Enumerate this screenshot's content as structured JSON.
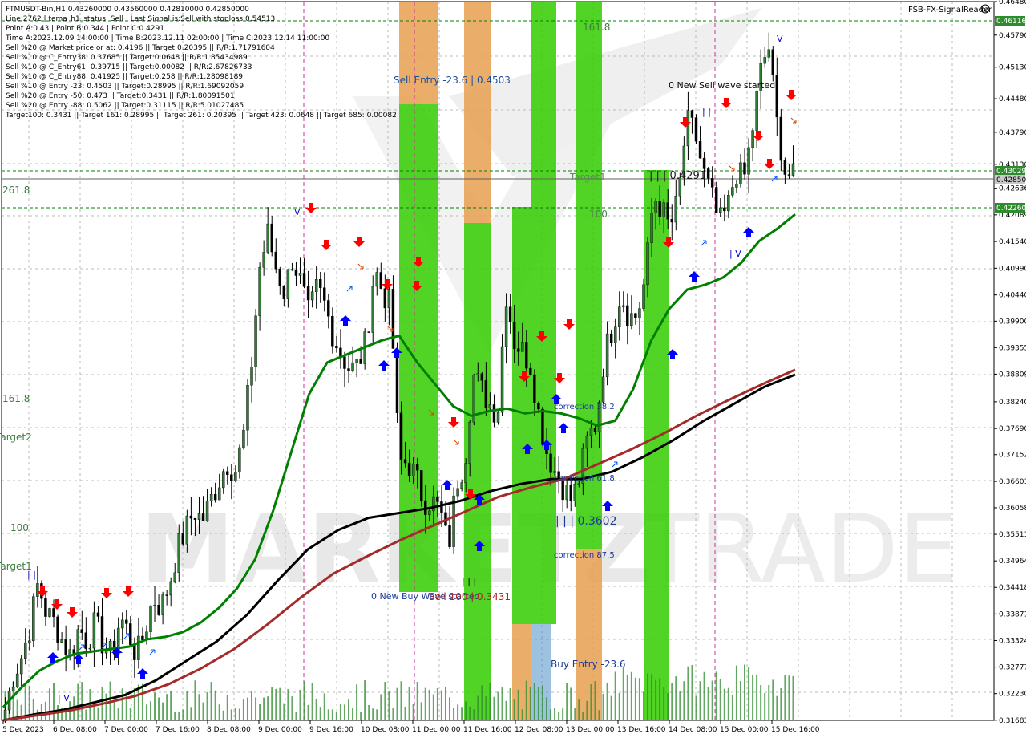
{
  "header": {
    "symbol_line": "FTMUSDT-Bin,H1  0.43260000 0.43560000 0.42810000 0.42850000",
    "lines": [
      "Line:2762 | tema_h1_status: Sell | Last Signal is:Sell with stoploss:0.54513",
      "Point A:0.43 | Point B:0.344 | Point C:0.4291",
      "Time A:2023.12.09 14:00:00 | Time B:2023.12.11 02:00:00 | Time C:2023.12.14 11:00:00",
      "Sell %20 @ Market price or at: 0.4196 || Target:0.20395 || R/R:1.71791604",
      "Sell %10 @ C_Entry38: 0.37685 || Target:0.0648 || R/R:1.85434989",
      "Sell %10 @ C_Entry61: 0.39715 || Target:0.00082 || R/R:2.67826733",
      "Sell %10 @ C_Entry88: 0.41925 || Target:0.258 || R/R:1.28098189",
      "Sell %10 @ Entry -23: 0.4503 || Target:0.28995 || R/R:1.69092059",
      "Sell %20 @ Entry -50: 0.473 || Target:0.3431 || R/R:1.80091501",
      "Sell %20 @ Entry -88: 0.5062 || Target:0.31115 || R/R:5.01027485",
      "Target100: 0.3431 || Target 161: 0.28995 || Target 261: 0.20395 || Target 423: 0.0648 || Target 685: 0.00082"
    ]
  },
  "brand": "FSB-FX-SignalReader",
  "watermark": {
    "left": "MARKETZ",
    "right": "TRADE"
  },
  "annotations": {
    "sell_entry": "Sell Entry -23.6 | 0.4503",
    "level_161_top": "161.8",
    "target1_right": "Target1",
    "point_c": "| | | 0.4291",
    "level_100_mid": "100",
    "new_sell_wave": "0 New Sell wave started",
    "correction_382": "correction 38.2",
    "correction_618": "correction 61.8",
    "point_b": "| | | 0.3602",
    "correction_875": "correction 87.5",
    "new_buy_wave": "0 New Buy Wave started",
    "sell_100": "Sell 100 | 0.3431",
    "buy_entry": "Buy Entry -23.6",
    "left_2618": "261.8",
    "left_1618": "161.8",
    "left_target2": "Target2",
    "left_100": "100",
    "left_target1": "Target1",
    "top_v": "V",
    "top_v2": "V",
    "bars_1": "| |",
    "bars_2": "| V",
    "bars_3": "| V",
    "bars_4": "| |",
    "bars_5": "| | |"
  },
  "colors": {
    "bull_green": "#2e7d32",
    "sell_arrow": "#ff0000",
    "buy_arrow": "#0000ff",
    "zone_green": "#33cc00",
    "zone_orange": "#e6a050",
    "ma_green": "#008000",
    "ma_black": "#000000",
    "ma_red": "#a52a2a",
    "level_line": "#008000",
    "current_price_bg": "#c0c0c0",
    "level_label_bg": "#2e8b2e"
  },
  "price_labels": {
    "upper_level": "0.46116",
    "target_level": "0.43029",
    "current_price": "0.42850",
    "lower_level": "0.42260"
  },
  "chart_data": {
    "type": "candlestick",
    "symbol": "FTMUSDT-Bin",
    "timeframe": "H1",
    "ylim": [
      0.3168,
      0.4648
    ],
    "y_ticks": [
      "0.46480",
      "0.45790",
      "0.45130",
      "0.44480",
      "0.43790",
      "0.43130",
      "0.42636",
      "0.42089",
      "0.41540",
      "0.40990",
      "0.40440",
      "0.39900",
      "0.39355",
      "0.38809",
      "0.38240",
      "0.37690",
      "0.37152",
      "0.36601",
      "0.36058",
      "0.35511",
      "0.34964",
      "0.34418",
      "0.33871",
      "0.33324",
      "0.32777",
      "0.32230",
      "0.31683"
    ],
    "x_ticks": [
      "5 Dec 2023",
      "6 Dec 08:00",
      "7 Dec 00:00",
      "7 Dec 16:00",
      "8 Dec 08:00",
      "9 Dec 00:00",
      "9 Dec 16:00",
      "10 Dec 08:00",
      "11 Dec 00:00",
      "11 Dec 16:00",
      "12 Dec 08:00",
      "13 Dec 00:00",
      "13 Dec 16:00",
      "14 Dec 08:00",
      "15 Dec 00:00",
      "15 Dec 16:00"
    ],
    "close_path": [
      0.319,
      0.326,
      0.33,
      0.336,
      0.345,
      0.339,
      0.337,
      0.333,
      0.33,
      0.336,
      0.333,
      0.337,
      0.332,
      0.33,
      0.338,
      0.335,
      0.33,
      0.335,
      0.342,
      0.34,
      0.345,
      0.352,
      0.356,
      0.36,
      0.358,
      0.362,
      0.366,
      0.37,
      0.368,
      0.375,
      0.39,
      0.41,
      0.417,
      0.41,
      0.405,
      0.412,
      0.407,
      0.4,
      0.406,
      0.402,
      0.396,
      0.392,
      0.389,
      0.39,
      0.395,
      0.41,
      0.405,
      0.402,
      0.37,
      0.37,
      0.367,
      0.362,
      0.362,
      0.36,
      0.352,
      0.366,
      0.37,
      0.388,
      0.385,
      0.382,
      0.38,
      0.405,
      0.395,
      0.393,
      0.39,
      0.38,
      0.372,
      0.368,
      0.365,
      0.362,
      0.367,
      0.375,
      0.378,
      0.392,
      0.398,
      0.405,
      0.4,
      0.4,
      0.408,
      0.425,
      0.422,
      0.418,
      0.424,
      0.44,
      0.438,
      0.43,
      0.425,
      0.419,
      0.422,
      0.43,
      0.428,
      0.438,
      0.45,
      0.456,
      0.44,
      0.43,
      0.4285
    ],
    "reference_levels": [
      0.46116,
      0.43029,
      0.4226
    ],
    "current_price": 0.4285,
    "moving_averages": [
      {
        "color": "#008000",
        "values": [
          0.3195,
          0.3235,
          0.327,
          0.329,
          0.3305,
          0.331,
          0.3315,
          0.332,
          0.3335,
          0.334,
          0.335,
          0.337,
          0.34,
          0.344,
          0.35,
          0.36,
          0.372,
          0.384,
          0.3905,
          0.392,
          0.3935,
          0.395,
          0.396,
          0.3905,
          0.386,
          0.3815,
          0.3795,
          0.3805,
          0.381,
          0.38,
          0.3805,
          0.38,
          0.379,
          0.3775,
          0.3785,
          0.385,
          0.395,
          0.4015,
          0.4055,
          0.4065,
          0.408,
          0.411,
          0.4155,
          0.418,
          0.421
        ]
      },
      {
        "color": "#000000",
        "values": [
          0.3168,
          0.318,
          0.319,
          0.3205,
          0.322,
          0.325,
          0.329,
          0.333,
          0.3385,
          0.3455,
          0.352,
          0.356,
          0.3585,
          0.3595,
          0.3605,
          0.362,
          0.364,
          0.3655,
          0.3665,
          0.3665,
          0.368,
          0.371,
          0.3745,
          0.3785,
          0.382,
          0.3855,
          0.388
        ]
      },
      {
        "color": "#a52a2a",
        "values": [
          0.3168,
          0.3178,
          0.3188,
          0.3202,
          0.3218,
          0.3242,
          0.3275,
          0.3315,
          0.3365,
          0.342,
          0.347,
          0.3505,
          0.3538,
          0.3568,
          0.3598,
          0.3628,
          0.3648,
          0.3665,
          0.3695,
          0.3725,
          0.3758,
          0.3795,
          0.3828,
          0.386,
          0.389
        ]
      }
    ]
  }
}
